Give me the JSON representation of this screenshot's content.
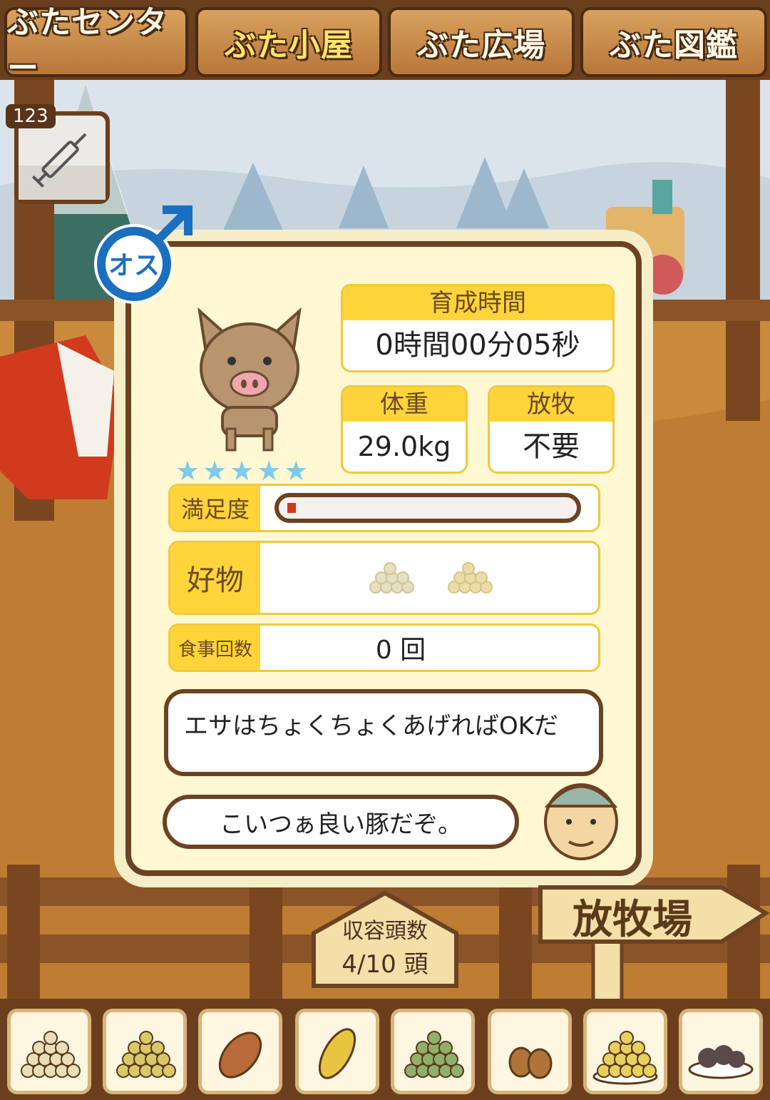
{
  "tabs": [
    {
      "label": "ぶたセンター"
    },
    {
      "label": "ぶた小屋"
    },
    {
      "label": "ぶた広場"
    },
    {
      "label": "ぶた図鑑"
    }
  ],
  "item": {
    "count": "123",
    "icon": "syringe-icon"
  },
  "pig": {
    "gender_label": "オス",
    "stars": "★★★★★",
    "raise_time_label": "育成時間",
    "raise_time_value": "0時間00分05秒",
    "weight_label": "体重",
    "weight_value": "29.0kg",
    "grazing_label": "放牧",
    "grazing_value": "不要",
    "satisfaction_label": "満足度",
    "satisfaction_fraction": 0.03,
    "favorite_label": "好物",
    "meals_label": "食事回数",
    "meals_value": "0 回",
    "advice": "エサはちょくちょくあげればOKだ",
    "comment": "こいつぁ良い豚だぞ。"
  },
  "capacity": {
    "label": "収容頭数",
    "value": "4/10 頭"
  },
  "sign": {
    "label": "放牧場"
  },
  "foods": [
    "feed-basic-icon",
    "feed-mixed-icon",
    "sweet-potato-icon",
    "corn-icon",
    "vegetable-feed-icon",
    "acorn-icon",
    "feed-plate-icon",
    "truffle-plate-icon"
  ],
  "colors": {
    "accent": "#ffd43a",
    "wood": "#6b4322",
    "male_blue": "#1a6fc0",
    "star": "#7ecbea",
    "bar_red": "#d23a1e"
  }
}
